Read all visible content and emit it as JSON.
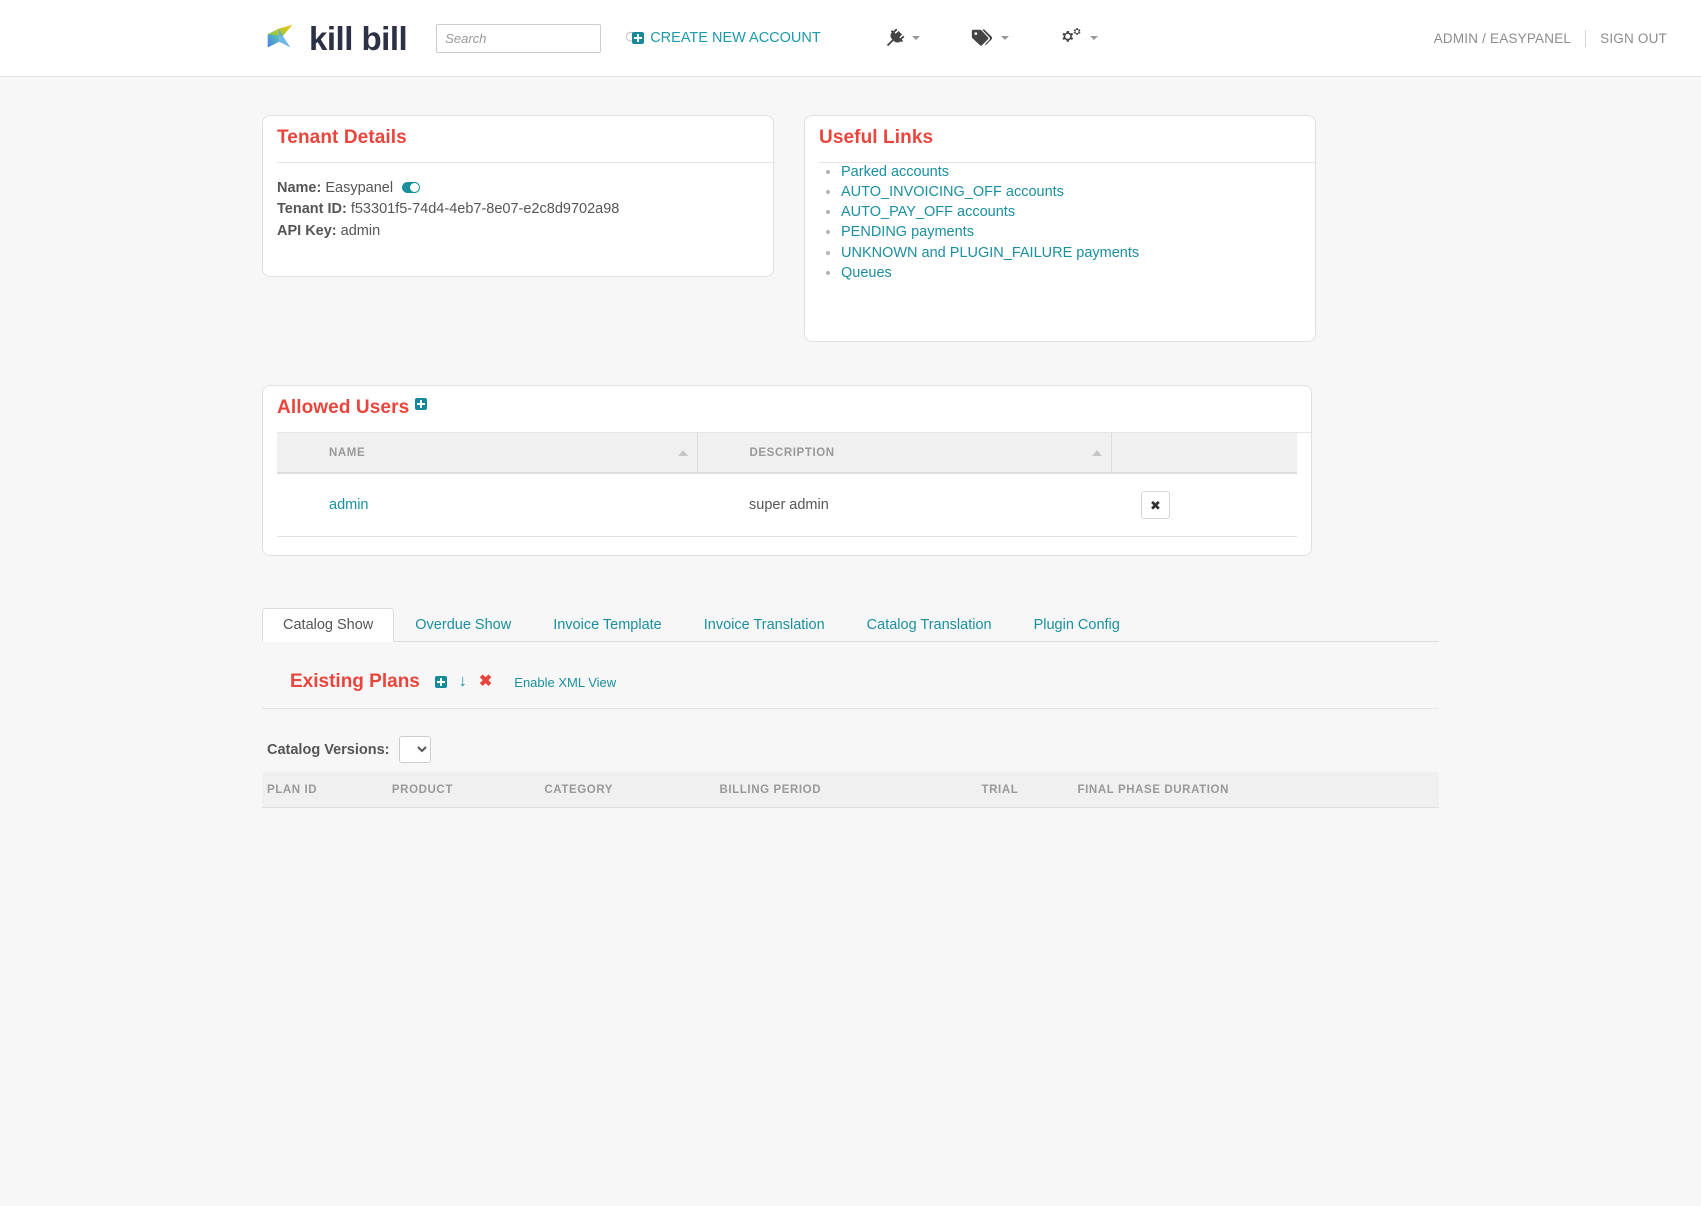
{
  "navbar": {
    "brand": "kill bill",
    "brand_icon": "killbill-logo-icon",
    "search": {
      "placeholder": "Search",
      "value": ""
    },
    "create_account_label": "CREATE NEW ACCOUNT",
    "icons": [
      {
        "name": "plug-icon",
        "label": ""
      },
      {
        "name": "tags-icon",
        "label": ""
      },
      {
        "name": "gears-icon",
        "label": ""
      }
    ],
    "user_label": "ADMIN / EASYPANEL",
    "sign_out_label": "SIGN OUT"
  },
  "tenant_details": {
    "title": "Tenant Details",
    "name_label": "Name:",
    "name_value": "Easypanel",
    "tenant_id_label": "Tenant ID:",
    "tenant_id_value": "f53301f5-74d4-4eb7-8e07-e2c8d9702a98",
    "api_key_label": "API Key:",
    "api_key_value": "admin",
    "toggle_state": "on"
  },
  "useful_links": {
    "title": "Useful Links",
    "links": [
      "Parked accounts",
      "AUTO_INVOICING_OFF accounts",
      "AUTO_PAY_OFF accounts",
      "PENDING payments",
      "UNKNOWN and PLUGIN_FAILURE payments",
      "Queues"
    ]
  },
  "allowed_users": {
    "title": "Allowed Users",
    "add_icon": "plus-square-icon",
    "columns": [
      "NAME",
      "DESCRIPTION",
      ""
    ],
    "rows": [
      {
        "name": "admin",
        "description": "super admin",
        "delete_label": "✖"
      }
    ]
  },
  "tabs": {
    "items": [
      {
        "label": "Catalog Show",
        "active": true
      },
      {
        "label": "Overdue Show",
        "active": false
      },
      {
        "label": "Invoice Template",
        "active": false
      },
      {
        "label": "Invoice Translation",
        "active": false
      },
      {
        "label": "Catalog Translation",
        "active": false
      },
      {
        "label": "Plugin Config",
        "active": false
      }
    ]
  },
  "existing_plans": {
    "title": "Existing Plans",
    "add_icon": "plus-square-icon",
    "download_icon": "arrow-down-icon",
    "download_glyph": "↓",
    "delete_icon": "cross-icon",
    "delete_glyph": "✖",
    "xml_view_label": "Enable XML View",
    "catalog_versions_label": "Catalog Versions:",
    "catalog_versions_selected": "",
    "catalog_versions_options": [
      ""
    ],
    "columns": [
      "PLAN ID",
      "PRODUCT",
      "CATEGORY",
      "BILLING PERIOD",
      "TRIAL",
      "FINAL PHASE DURATION"
    ],
    "rows": []
  },
  "colors": {
    "accent_red": "#e8453c",
    "link_teal": "#1b8f9e",
    "text_gray": "#555555",
    "page_bg": "#f7f7f7"
  }
}
